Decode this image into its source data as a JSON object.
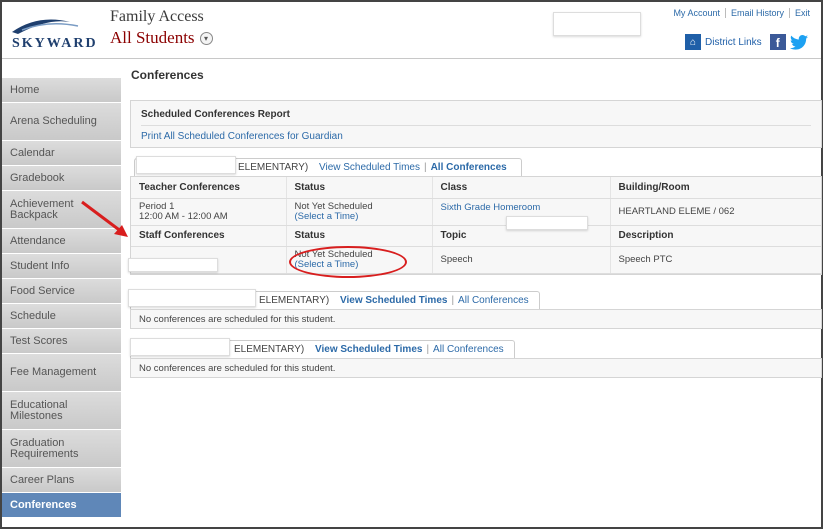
{
  "header": {
    "logo_text": "SKYWARD",
    "app_title": "Family Access",
    "student_selector": "All Students",
    "top_links": [
      "My Account",
      "Email History",
      "Exit"
    ],
    "district_links": "District Links"
  },
  "sidebar": {
    "items": [
      {
        "label": "Home"
      },
      {
        "label": "Arena Scheduling"
      },
      {
        "label": "Calendar"
      },
      {
        "label": "Gradebook"
      },
      {
        "label": "Achievement Backpack"
      },
      {
        "label": "Attendance"
      },
      {
        "label": "Student Info"
      },
      {
        "label": "Food Service"
      },
      {
        "label": "Schedule"
      },
      {
        "label": "Test Scores"
      },
      {
        "label": "Fee Management"
      },
      {
        "label": "Educational Milestones"
      },
      {
        "label": "Graduation Requirements"
      },
      {
        "label": "Career Plans"
      },
      {
        "label": "Conferences"
      }
    ],
    "active": "Conferences"
  },
  "main": {
    "page_title": "Conferences",
    "report": {
      "title": "Scheduled Conferences Report",
      "link": "Print All Scheduled Conferences for Guardian"
    },
    "students": [
      {
        "school_suffix": "ELEMENTARY)",
        "view_times": "View Scheduled Times",
        "all_conferences": "All Conferences",
        "teacher_headers": [
          "Teacher Conferences",
          "Status",
          "Class",
          "Building/Room"
        ],
        "teacher_row": {
          "period": "Period 1",
          "time": "12:00 AM - 12:00 AM",
          "status": "Not Yet Scheduled",
          "select": "(Select a Time)",
          "class": "Sixth Grade Homeroom",
          "room": "HEARTLAND ELEME / 062"
        },
        "staff_headers": [
          "Staff Conferences",
          "Status",
          "Topic",
          "Description"
        ],
        "staff_row": {
          "status": "Not Yet Scheduled",
          "select": "(Select a Time)",
          "topic": "Speech",
          "description": "Speech PTC"
        }
      },
      {
        "school_suffix": "ELEMENTARY)",
        "view_times": "View Scheduled Times",
        "all_conferences": "All Conferences",
        "empty_message": "No conferences are scheduled for this student."
      },
      {
        "school_suffix": "ELEMENTARY)",
        "view_times": "View Scheduled Times",
        "all_conferences": "All Conferences",
        "empty_message": "No conferences are scheduled for this student."
      }
    ]
  },
  "colors": {
    "link": "#2c6aa8",
    "active_nav": "#5f87b8",
    "annotation": "#d81e1e",
    "student_name": "#8b0000"
  }
}
